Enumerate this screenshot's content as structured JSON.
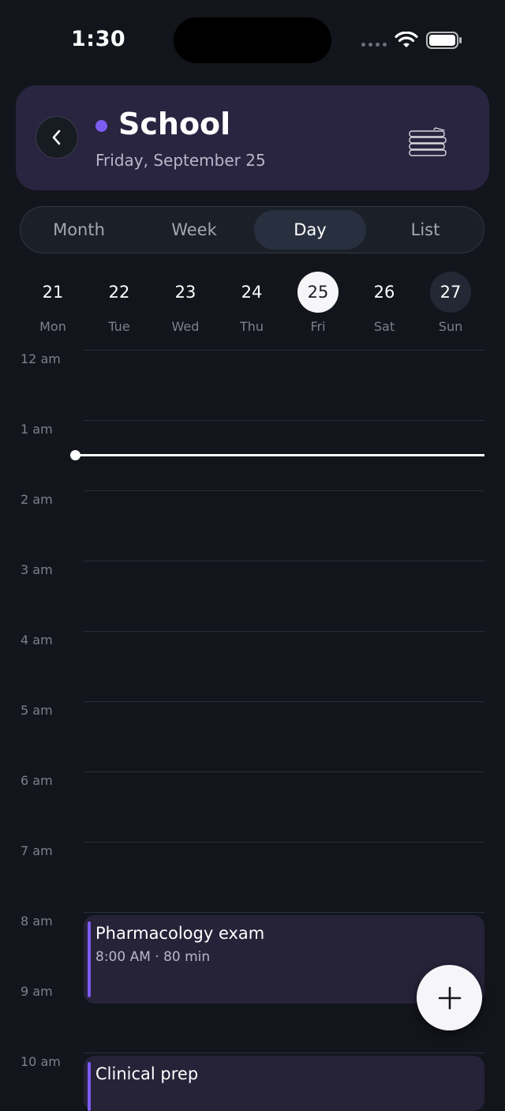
{
  "status_bar": {
    "time": "1:30"
  },
  "header": {
    "title": "School",
    "subtitle": "Friday, September 25",
    "accent": "#7c5cf0"
  },
  "view_tabs": [
    {
      "label": "Month",
      "active": false
    },
    {
      "label": "Week",
      "active": false
    },
    {
      "label": "Day",
      "active": true
    },
    {
      "label": "List",
      "active": false
    }
  ],
  "week_days": [
    {
      "num": "21",
      "name": "Mon"
    },
    {
      "num": "22",
      "name": "Tue"
    },
    {
      "num": "23",
      "name": "Wed"
    },
    {
      "num": "24",
      "name": "Thu"
    },
    {
      "num": "25",
      "name": "Fri",
      "selected": true
    },
    {
      "num": "26",
      "name": "Sat"
    },
    {
      "num": "27",
      "name": "Sun",
      "today": true
    }
  ],
  "hours": [
    "12 am",
    "1 am",
    "2 am",
    "3 am",
    "4 am",
    "5 am",
    "6 am",
    "7 am",
    "8 am",
    "9 am",
    "10 am"
  ],
  "events": [
    {
      "title": "Pharmacology exam",
      "meta": "8:00 AM · 80 min"
    },
    {
      "title": "Clinical prep",
      "meta": ""
    }
  ]
}
